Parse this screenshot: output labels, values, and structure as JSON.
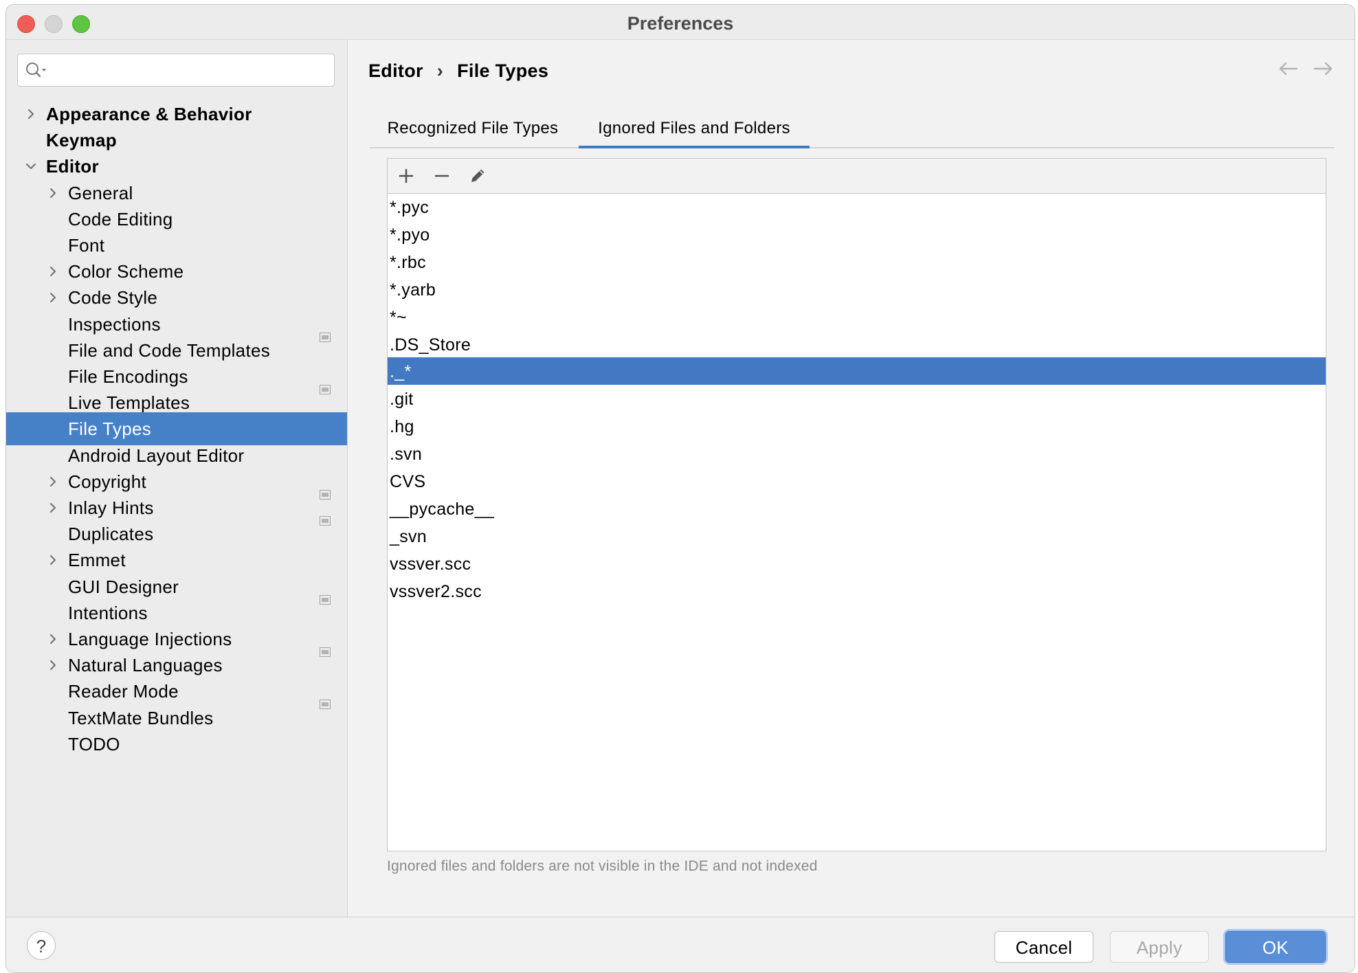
{
  "window": {
    "title": "Preferences"
  },
  "search": {
    "placeholder": ""
  },
  "sidebar": {
    "items": [
      {
        "label": "Appearance & Behavior",
        "level": 0,
        "expandable": true,
        "expanded": false,
        "selected": false,
        "project_icon": false
      },
      {
        "label": "Keymap",
        "level": 0,
        "expandable": false,
        "expanded": false,
        "selected": false,
        "project_icon": false
      },
      {
        "label": "Editor",
        "level": 0,
        "expandable": true,
        "expanded": true,
        "selected": false,
        "project_icon": false
      },
      {
        "label": "General",
        "level": 1,
        "expandable": true,
        "expanded": false,
        "selected": false,
        "project_icon": false
      },
      {
        "label": "Code Editing",
        "level": 1,
        "expandable": false,
        "expanded": false,
        "selected": false,
        "project_icon": false
      },
      {
        "label": "Font",
        "level": 1,
        "expandable": false,
        "expanded": false,
        "selected": false,
        "project_icon": false
      },
      {
        "label": "Color Scheme",
        "level": 1,
        "expandable": true,
        "expanded": false,
        "selected": false,
        "project_icon": false
      },
      {
        "label": "Code Style",
        "level": 1,
        "expandable": true,
        "expanded": false,
        "selected": false,
        "project_icon": false
      },
      {
        "label": "Inspections",
        "level": 1,
        "expandable": false,
        "expanded": false,
        "selected": false,
        "project_icon": true
      },
      {
        "label": "File and Code Templates",
        "level": 1,
        "expandable": false,
        "expanded": false,
        "selected": false,
        "project_icon": false
      },
      {
        "label": "File Encodings",
        "level": 1,
        "expandable": false,
        "expanded": false,
        "selected": false,
        "project_icon": true
      },
      {
        "label": "Live Templates",
        "level": 1,
        "expandable": false,
        "expanded": false,
        "selected": false,
        "project_icon": false
      },
      {
        "label": "File Types",
        "level": 1,
        "expandable": false,
        "expanded": false,
        "selected": true,
        "project_icon": false
      },
      {
        "label": "Android Layout Editor",
        "level": 1,
        "expandable": false,
        "expanded": false,
        "selected": false,
        "project_icon": false
      },
      {
        "label": "Copyright",
        "level": 1,
        "expandable": true,
        "expanded": false,
        "selected": false,
        "project_icon": true
      },
      {
        "label": "Inlay Hints",
        "level": 1,
        "expandable": true,
        "expanded": false,
        "selected": false,
        "project_icon": true
      },
      {
        "label": "Duplicates",
        "level": 1,
        "expandable": false,
        "expanded": false,
        "selected": false,
        "project_icon": false
      },
      {
        "label": "Emmet",
        "level": 1,
        "expandable": true,
        "expanded": false,
        "selected": false,
        "project_icon": false
      },
      {
        "label": "GUI Designer",
        "level": 1,
        "expandable": false,
        "expanded": false,
        "selected": false,
        "project_icon": true
      },
      {
        "label": "Intentions",
        "level": 1,
        "expandable": false,
        "expanded": false,
        "selected": false,
        "project_icon": false
      },
      {
        "label": "Language Injections",
        "level": 1,
        "expandable": true,
        "expanded": false,
        "selected": false,
        "project_icon": true
      },
      {
        "label": "Natural Languages",
        "level": 1,
        "expandable": true,
        "expanded": false,
        "selected": false,
        "project_icon": false
      },
      {
        "label": "Reader Mode",
        "level": 1,
        "expandable": false,
        "expanded": false,
        "selected": false,
        "project_icon": true
      },
      {
        "label": "TextMate Bundles",
        "level": 1,
        "expandable": false,
        "expanded": false,
        "selected": false,
        "project_icon": false
      },
      {
        "label": "TODO",
        "level": 1,
        "expandable": false,
        "expanded": false,
        "selected": false,
        "project_icon": false
      }
    ]
  },
  "breadcrumb": {
    "parent": "Editor",
    "separator": "›",
    "current": "File Types"
  },
  "tabs": [
    {
      "label": "Recognized File Types",
      "active": false
    },
    {
      "label": "Ignored Files and Folders",
      "active": true
    }
  ],
  "toolbar": {
    "add_icon": "plus-icon",
    "remove_icon": "minus-icon",
    "edit_icon": "pencil-icon"
  },
  "ignored_list": {
    "items": [
      {
        "text": "*.pyc",
        "selected": false
      },
      {
        "text": "*.pyo",
        "selected": false
      },
      {
        "text": "*.rbc",
        "selected": false
      },
      {
        "text": "*.yarb",
        "selected": false
      },
      {
        "text": "*~",
        "selected": false
      },
      {
        "text": ".DS_Store",
        "selected": false
      },
      {
        "text": "._*",
        "selected": true
      },
      {
        "text": ".git",
        "selected": false
      },
      {
        "text": ".hg",
        "selected": false
      },
      {
        "text": ".svn",
        "selected": false
      },
      {
        "text": "CVS",
        "selected": false
      },
      {
        "text": "__pycache__",
        "selected": false
      },
      {
        "text": "_svn",
        "selected": false
      },
      {
        "text": "vssver.scc",
        "selected": false
      },
      {
        "text": "vssver2.scc",
        "selected": false
      }
    ]
  },
  "hint": "Ignored files and folders are not visible in the IDE and not indexed",
  "footer": {
    "help_label": "?",
    "cancel_label": "Cancel",
    "apply_label": "Apply",
    "ok_label": "OK"
  },
  "colors": {
    "selection": "#4680c7",
    "accent": "#3f7bc4",
    "ok_button": "#5a8fd8"
  }
}
